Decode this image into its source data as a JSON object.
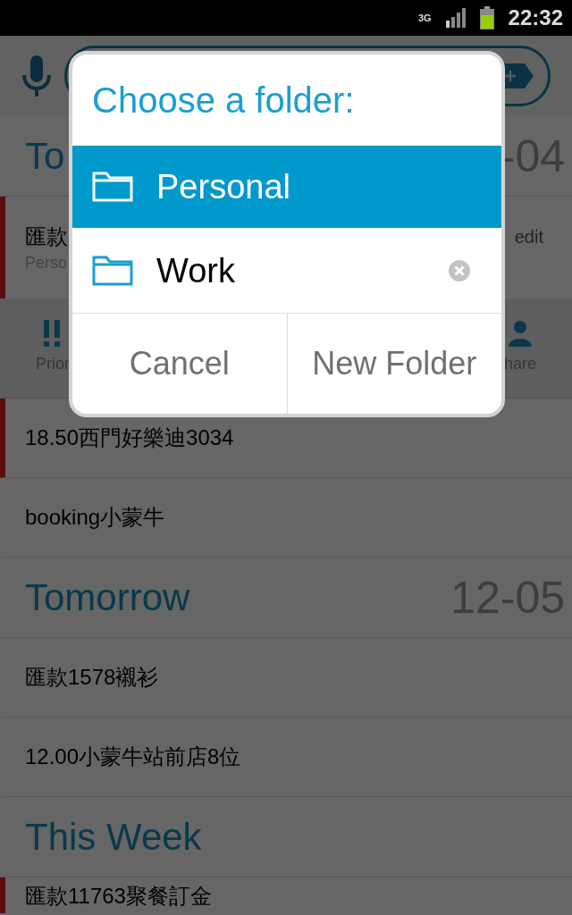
{
  "status_bar": {
    "network": "3G",
    "time": "22:32"
  },
  "sections": [
    {
      "title": "To",
      "date": "-04",
      "items": [
        {
          "kind": "expanded",
          "text": "匯款",
          "folder": "Perso",
          "edit": "edit",
          "priority": true,
          "actions": [
            {
              "label": "Prior",
              "kind": "priority"
            },
            {
              "label": "hare",
              "kind": "person"
            }
          ]
        },
        {
          "kind": "task",
          "text": "18.50西門好樂迪3034",
          "priority": true
        },
        {
          "kind": "task",
          "text": "booking小蒙牛",
          "priority": false
        }
      ]
    },
    {
      "title": "Tomorrow",
      "date": "12-05",
      "items": [
        {
          "kind": "task",
          "text": "匯款1578襯衫",
          "priority": false
        },
        {
          "kind": "task",
          "text": "12.00小蒙牛站前店8位",
          "priority": false
        }
      ]
    },
    {
      "title": "This Week",
      "items": [
        {
          "kind": "partial",
          "text": "匯款11763聚餐訂金",
          "priority": true
        }
      ]
    }
  ],
  "dialog": {
    "title": "Choose a folder:",
    "folders": [
      {
        "name": "Personal",
        "selected": true,
        "removable": false
      },
      {
        "name": "Work",
        "selected": false,
        "removable": true
      }
    ],
    "buttons": [
      "Cancel",
      "New Folder"
    ]
  }
}
